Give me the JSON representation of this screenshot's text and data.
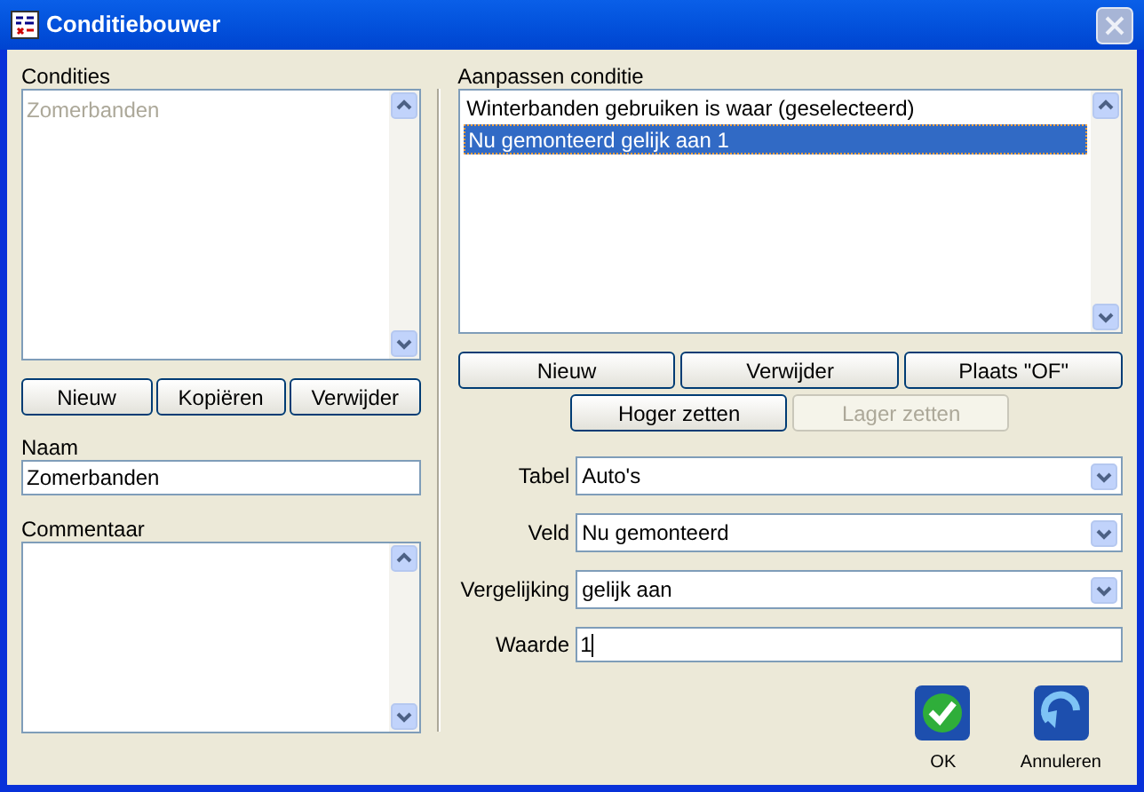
{
  "window": {
    "title": "Conditiebouwer"
  },
  "conditions": {
    "label": "Condities",
    "items": [
      {
        "text": "Zomerbanden",
        "disabled": true
      }
    ],
    "buttons": [
      {
        "label": "Nieuw"
      },
      {
        "label": "Kopiëren"
      },
      {
        "label": "Verwijder"
      }
    ]
  },
  "name": {
    "label": "Naam",
    "value": "Zomerbanden"
  },
  "comment": {
    "label": "Commentaar"
  },
  "edit": {
    "label": "Aanpassen conditie",
    "items": [
      {
        "text": "Winterbanden gebruiken is waar (geselecteerd)",
        "selected": false
      },
      {
        "text": "Nu gemonteerd gelijk aan 1",
        "selected": true
      }
    ],
    "buttons": [
      {
        "label": "Nieuw",
        "disabled": false
      },
      {
        "label": "Verwijder",
        "disabled": false
      },
      {
        "label": "Plaats \"OF\"",
        "disabled": false
      }
    ],
    "move_buttons": [
      {
        "label": "Hoger zetten",
        "disabled": false
      },
      {
        "label": "Lager zetten",
        "disabled": true
      }
    ],
    "fields": [
      {
        "kind": "select",
        "label": "Tabel",
        "value": "Auto's"
      },
      {
        "kind": "select",
        "label": "Veld",
        "value": "Nu gemonteerd"
      },
      {
        "kind": "select",
        "label": "Vergelijking",
        "value": "gelijk aan"
      },
      {
        "kind": "input",
        "label": "Waarde",
        "value": "1"
      }
    ]
  },
  "actions": [
    {
      "kind": "ok",
      "label": "OK"
    },
    {
      "kind": "cancel",
      "label": "Annuleren"
    }
  ]
}
